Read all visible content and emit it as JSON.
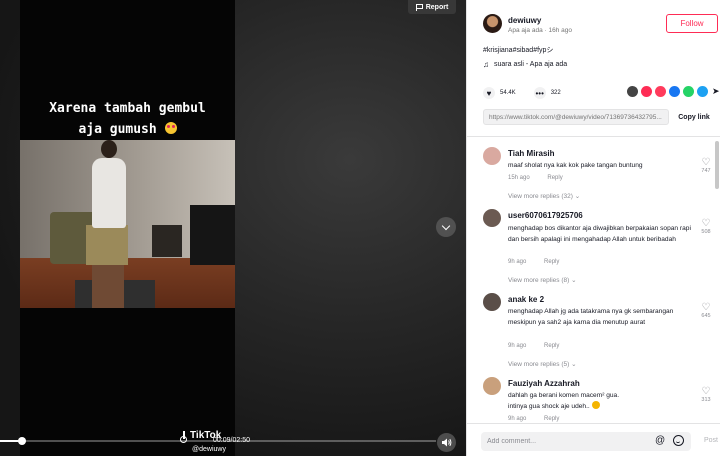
{
  "video": {
    "caption_line1": "Xarena tambah gembul",
    "caption_line2": "aja gumush",
    "caption_emoji": "face-with-heart-eyes",
    "report_label": "Report",
    "time": "00:09/02:50",
    "progress": 0.05,
    "watermark_brand": "TikTok",
    "watermark_user": "@dewiuwy"
  },
  "author": {
    "username": "dewiuwy",
    "meta": "Apa aja ada · 16h ago",
    "follow_label": "Follow"
  },
  "post": {
    "hashtags": "#krisjiana#sibad#fypシ",
    "music": "suara asli - Apa aja ada",
    "likes": "54.4K",
    "comments": "322",
    "link": "https://www.tiktok.com/@dewiuwy/video/71369736432795...",
    "copy_label": "Copy link"
  },
  "share_colors": [
    "#444444",
    "#fe2c55",
    "#ff3b5c",
    "#1877f2",
    "#25d366",
    "#1da1f2"
  ],
  "comments": [
    {
      "name": "Tiah Mirasih",
      "text": "maaf sholat nya kak kok pake tangan buntung",
      "time": "15h ago",
      "reply": "Reply",
      "likes": "747",
      "more": "View more replies (32)",
      "avatar_color": "#d9a9a0"
    },
    {
      "name": "user6070617925706",
      "text": "menghadap bos dikantor aja diwajibkan berpakaian sopan rapi dan bersih apalagi ini mengahadap Allah untuk beribadah",
      "time": "9h ago",
      "reply": "Reply",
      "likes": "508",
      "more": "View more replies (8)",
      "avatar_color": "#6b5a52"
    },
    {
      "name": "anak ke 2",
      "text": "menghadap Allah jg ada tatakrama nya gk sembarangan meskipun ya sah2 aja karna dia menutup aurat",
      "time": "9h ago",
      "reply": "Reply",
      "likes": "645",
      "more": "View more replies (5)",
      "avatar_color": "#5a4e48"
    },
    {
      "name": "Fauziyah Azzahrah",
      "text": "dahlah ga berani komen macem² gua.",
      "text2": "intinya gua shock aje udeh..",
      "time": "9h ago",
      "reply": "Reply",
      "likes": "313",
      "avatar_color": "#c9a07c"
    }
  ],
  "footer": {
    "placeholder": "Add comment...",
    "post_label": "Post"
  }
}
